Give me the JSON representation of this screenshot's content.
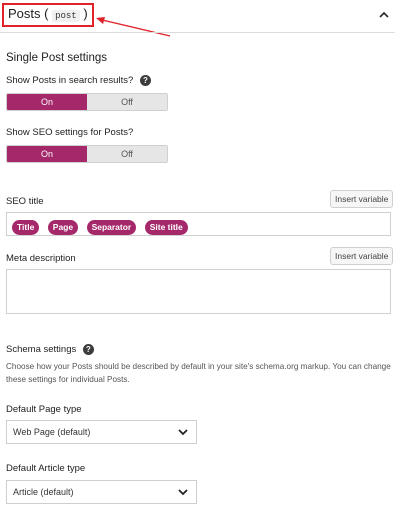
{
  "header": {
    "title": "Posts",
    "code": "post"
  },
  "single": {
    "title": "Single Post settings",
    "show_search_label": "Show Posts in search results?",
    "show_seo_label": "Show SEO settings for Posts?",
    "toggle_on": "On",
    "toggle_off": "Off"
  },
  "seo_title": {
    "label": "SEO title",
    "insert_label": "Insert variable",
    "pills": [
      "Title",
      "Page",
      "Separator",
      "Site title"
    ]
  },
  "meta": {
    "label": "Meta description",
    "insert_label": "Insert variable"
  },
  "schema": {
    "title": "Schema settings",
    "description": "Choose how your Posts should be described by default in your site's schema.org markup. You can change these settings for individual Posts.",
    "page_type_label": "Default Page type",
    "page_type_value": "Web Page (default)",
    "article_type_label": "Default Article type",
    "article_type_value": "Article (default)"
  },
  "colors": {
    "accent": "#a4286a",
    "annotation": "#e0222a"
  }
}
